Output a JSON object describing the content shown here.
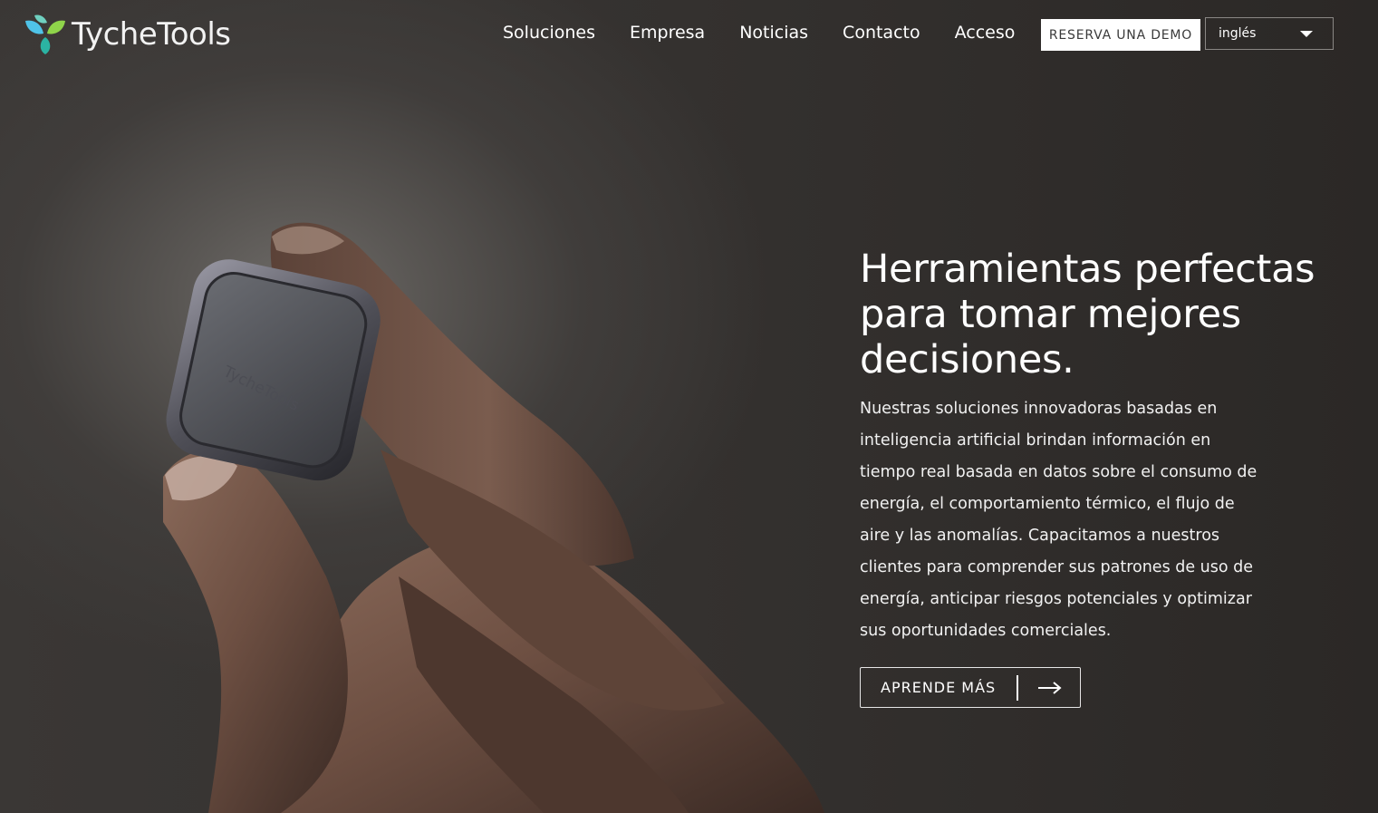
{
  "brand": {
    "name": "TycheTools",
    "device_engraving": "TycheTools",
    "colors": {
      "leaf_left": "#4fc3e8",
      "leaf_right": "#8fd44a",
      "leaf_bottom": "#2bb3a3"
    }
  },
  "nav": {
    "items": [
      {
        "label": "Soluciones"
      },
      {
        "label": "Empresa"
      },
      {
        "label": "Noticias"
      },
      {
        "label": "Contacto"
      },
      {
        "label": "Acceso"
      }
    ],
    "demo_label": "RESERVA UNA DEMO",
    "language": "inglés"
  },
  "hero": {
    "title": "Herramientas perfectas para tomar mejores decisiones.",
    "body": "Nuestras soluciones innovadoras basadas en inteligencia artificial brindan información en tiempo real basada en datos sobre el consumo de energía, el comportamiento térmico, el flujo de aire y las anomalías. Capacitamos a nuestros clientes para comprender sus patrones de uso de energía, anticipar riesgos potenciales y optimizar sus oportunidades comerciales.",
    "cta_label": "APRENDE MÁS"
  }
}
